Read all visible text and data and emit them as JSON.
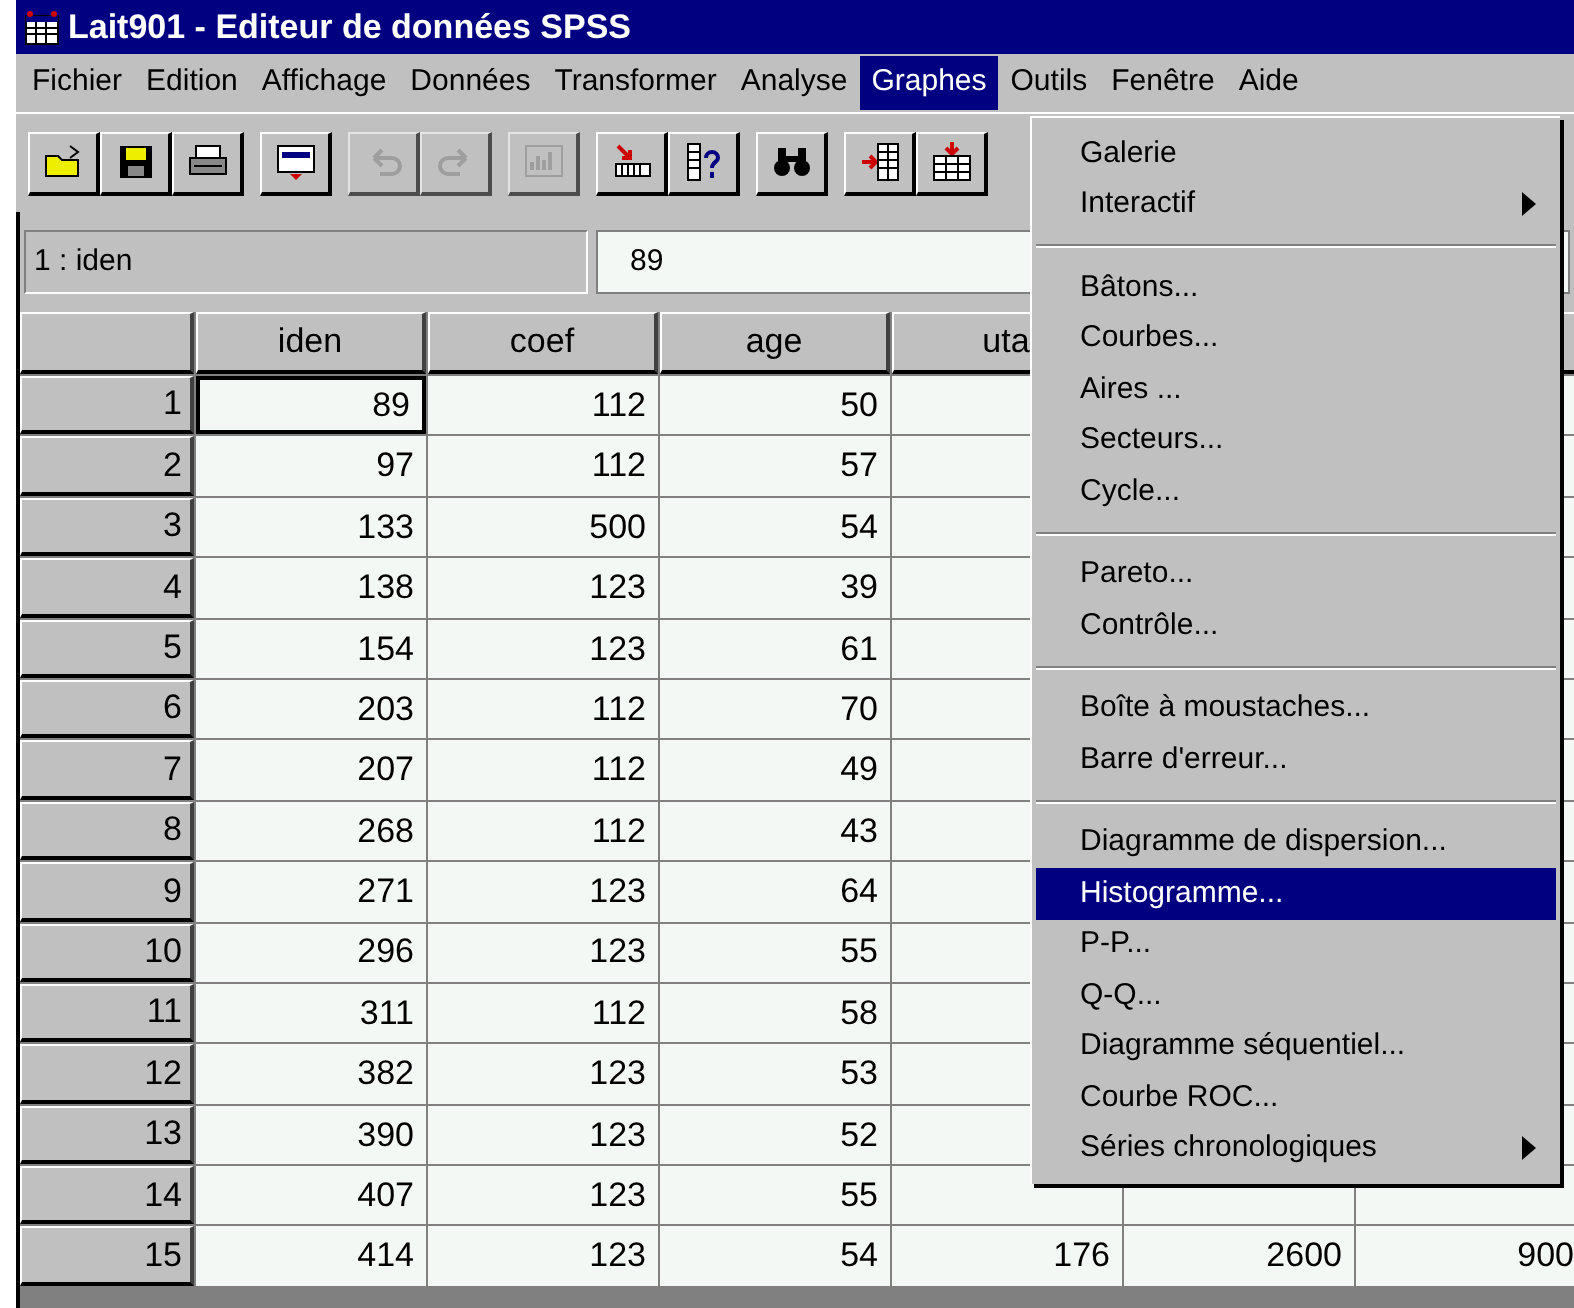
{
  "window": {
    "title": "Lait901 - Editeur de données SPSS"
  },
  "menu_bar": [
    {
      "label": "Fichier",
      "selected": false
    },
    {
      "label": "Edition",
      "selected": false
    },
    {
      "label": "Affichage",
      "selected": false
    },
    {
      "label": "Données",
      "selected": false
    },
    {
      "label": "Transformer",
      "selected": false
    },
    {
      "label": "Analyse",
      "selected": false
    },
    {
      "label": "Graphes",
      "selected": true
    },
    {
      "label": "Outils",
      "selected": false
    },
    {
      "label": "Fenêtre",
      "selected": false
    },
    {
      "label": "Aide",
      "selected": false
    }
  ],
  "toolbar": [
    [
      {
        "kind": "open",
        "disabled": false
      },
      {
        "kind": "save",
        "disabled": false
      },
      {
        "kind": "print",
        "disabled": false
      }
    ],
    [
      {
        "kind": "dialog",
        "disabled": false
      }
    ],
    [
      {
        "kind": "undo",
        "disabled": true
      },
      {
        "kind": "redo",
        "disabled": true
      }
    ],
    [
      {
        "kind": "chart",
        "disabled": true
      }
    ],
    [
      {
        "kind": "goto",
        "disabled": false
      },
      {
        "kind": "varinfo",
        "disabled": false
      }
    ],
    [
      {
        "kind": "find",
        "disabled": false
      }
    ],
    [
      {
        "kind": "insertcol",
        "disabled": false
      },
      {
        "kind": "insertrow",
        "disabled": false
      }
    ]
  ],
  "cell_reference": {
    "name": "1 : iden",
    "value": "89"
  },
  "table": {
    "columns": [
      "iden",
      "coef",
      "age",
      "uta"
    ],
    "rows": [
      {
        "header": "1",
        "cells": [
          "89",
          "112",
          "50"
        ],
        "selected": true
      },
      {
        "header": "2",
        "cells": [
          "97",
          "112",
          "57"
        ],
        "selected": false
      },
      {
        "header": "3",
        "cells": [
          "133",
          "500",
          "54"
        ],
        "selected": false
      },
      {
        "header": "4",
        "cells": [
          "138",
          "123",
          "39"
        ],
        "selected": false
      },
      {
        "header": "5",
        "cells": [
          "154",
          "123",
          "61"
        ],
        "selected": false
      },
      {
        "header": "6",
        "cells": [
          "203",
          "112",
          "70"
        ],
        "selected": false
      },
      {
        "header": "7",
        "cells": [
          "207",
          "112",
          "49"
        ],
        "selected": false
      },
      {
        "header": "8",
        "cells": [
          "268",
          "112",
          "43"
        ],
        "selected": false
      },
      {
        "header": "9",
        "cells": [
          "271",
          "123",
          "64"
        ],
        "selected": false
      },
      {
        "header": "10",
        "cells": [
          "296",
          "123",
          "55"
        ],
        "selected": false
      },
      {
        "header": "11",
        "cells": [
          "311",
          "112",
          "58"
        ],
        "selected": false
      },
      {
        "header": "12",
        "cells": [
          "382",
          "123",
          "53"
        ],
        "selected": false
      },
      {
        "header": "13",
        "cells": [
          "390",
          "123",
          "52"
        ],
        "selected": false
      },
      {
        "header": "14",
        "cells": [
          "407",
          "123",
          "55"
        ],
        "selected": false
      },
      {
        "header": "15",
        "cells": [
          "414",
          "123",
          "54",
          "176",
          "2600",
          "900"
        ],
        "selected": false
      }
    ]
  },
  "graphs_menu": [
    [
      {
        "label": "Galerie",
        "submenu": false,
        "selected": false
      },
      {
        "label": "Interactif",
        "submenu": true,
        "selected": false
      }
    ],
    [
      {
        "label": "Bâtons...",
        "submenu": false,
        "selected": false
      },
      {
        "label": "Courbes...",
        "submenu": false,
        "selected": false
      },
      {
        "label": "Aires ...",
        "submenu": false,
        "selected": false
      },
      {
        "label": "Secteurs...",
        "submenu": false,
        "selected": false
      },
      {
        "label": "Cycle...",
        "submenu": false,
        "selected": false
      }
    ],
    [
      {
        "label": "Pareto...",
        "submenu": false,
        "selected": false
      },
      {
        "label": "Contrôle...",
        "submenu": false,
        "selected": false
      }
    ],
    [
      {
        "label": "Boîte à moustaches...",
        "submenu": false,
        "selected": false
      },
      {
        "label": "Barre d'erreur...",
        "submenu": false,
        "selected": false
      }
    ],
    [
      {
        "label": "Diagramme de dispersion...",
        "submenu": false,
        "selected": false
      },
      {
        "label": "Histogramme...",
        "submenu": false,
        "selected": true
      },
      {
        "label": "P-P...",
        "submenu": false,
        "selected": false
      },
      {
        "label": "Q-Q...",
        "submenu": false,
        "selected": false
      },
      {
        "label": "Diagramme séquentiel...",
        "submenu": false,
        "selected": false
      },
      {
        "label": "Courbe ROC...",
        "submenu": false,
        "selected": false
      },
      {
        "label": "Séries chronologiques",
        "submenu": true,
        "selected": false
      }
    ]
  ]
}
